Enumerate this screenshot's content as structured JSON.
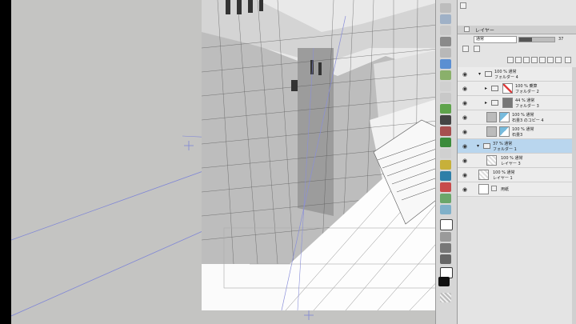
{
  "layer_panel": {
    "tab_label": "レイヤー",
    "blend_mode": "通常",
    "opacity_value": "37",
    "opacity_fraction": 0.37,
    "layers": [
      {
        "line1": "100 %  通常",
        "line2": "フォルダー 4",
        "kind": "folder"
      },
      {
        "line1": "100 %  乗算",
        "line2": "フォルダー 2",
        "kind": "folder"
      },
      {
        "line1": "44 %  通常",
        "line2": "フォルダー 3",
        "kind": "folder"
      },
      {
        "line1": "100 %  通常",
        "line2": "石畳3 のコピー 4",
        "kind": "layer"
      },
      {
        "line1": "100 %  通常",
        "line2": "石畳3",
        "kind": "layer"
      },
      {
        "line1": "37 %  通常",
        "line2": "フォルダー 1",
        "kind": "folder",
        "selected": true
      },
      {
        "line1": "100 %  通常",
        "line2": "レイヤー 3",
        "kind": "layer"
      },
      {
        "line1": "100 %  通常",
        "line2": "レイヤー 1",
        "kind": "layer"
      },
      {
        "line1": "",
        "line2": "用紙",
        "kind": "paper"
      }
    ]
  },
  "colors": {
    "canvas_bg": "#c4c4c2",
    "selected_row": "#b9d6ee",
    "guide": "#7f86d6"
  }
}
